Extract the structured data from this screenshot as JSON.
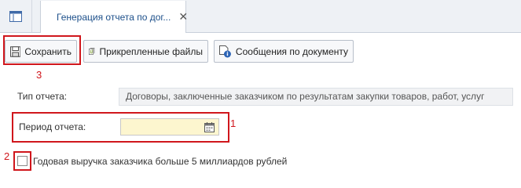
{
  "tab": {
    "title": "Генерация отчета по дог...",
    "close_glyph": "✕",
    "icons": [
      "grid-icon",
      "document-icon"
    ]
  },
  "toolbar": {
    "save_label": "Сохранить",
    "attachments_label": "Прикрепленные файлы",
    "messages_label": "Сообщения по документу",
    "icons": [
      "save-icon",
      "attachments-icon",
      "messages-icon"
    ]
  },
  "form": {
    "report_type_label": "Тип отчета:",
    "report_type_value": "Договоры, заключенные заказчиком по результатам закупки товаров, работ, услуг",
    "period_label": "Период отчета:",
    "period_value": "",
    "revenue_checkbox_label": "Годовая выручка заказчика больше 5 миллиардов рублей",
    "revenue_checkbox_checked": false
  },
  "annotations": {
    "save_marker": "3",
    "period_marker": "1",
    "checkbox_marker": "2",
    "color": "#d0161c"
  }
}
